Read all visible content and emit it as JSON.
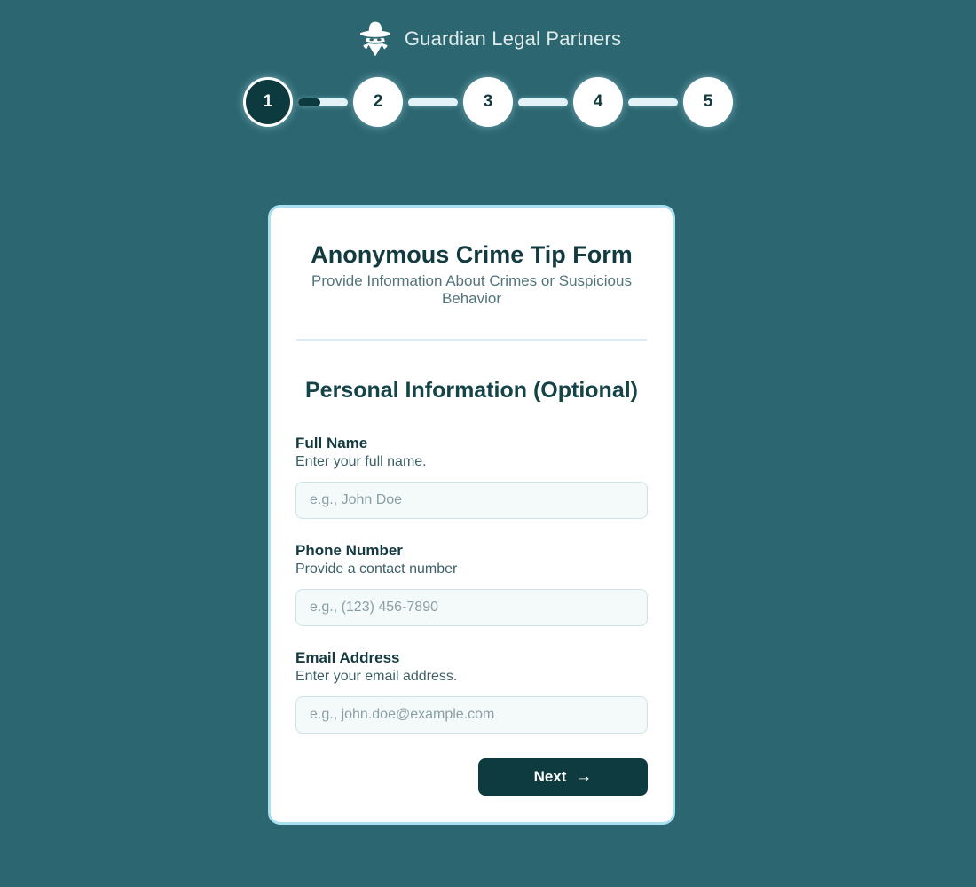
{
  "brand": {
    "name": "Guardian Legal Partners",
    "icon": "detective-icon"
  },
  "stepper": {
    "steps": [
      {
        "label": "1",
        "state": "active"
      },
      {
        "label": "2",
        "state": "upcoming"
      },
      {
        "label": "3",
        "state": "upcoming"
      },
      {
        "label": "4",
        "state": "upcoming"
      },
      {
        "label": "5",
        "state": "upcoming"
      }
    ],
    "connectors": [
      {
        "progress_percent": 45
      },
      {
        "progress_percent": 0
      },
      {
        "progress_percent": 0
      },
      {
        "progress_percent": 0
      }
    ]
  },
  "card": {
    "title": "Anonymous Crime Tip Form",
    "subtitle": "Provide Information About Crimes or Suspicious Behavior",
    "section_title": "Personal Information (Optional)",
    "fields": [
      {
        "label": "Full Name",
        "help": "Enter your full name.",
        "placeholder": "e.g., John Doe",
        "value": ""
      },
      {
        "label": "Phone Number",
        "help": "Provide a contact number",
        "placeholder": "e.g., (123) 456-7890",
        "value": ""
      },
      {
        "label": "Email Address",
        "help": "Enter your email address.",
        "placeholder": "e.g., john.doe@example.com",
        "value": ""
      }
    ],
    "next_label": "Next",
    "next_arrow": "→"
  },
  "colors": {
    "page_background": "#2c6670",
    "card_border": "#a9dff1",
    "accent_dark": "#0e3b3f",
    "title_text": "#123a3f",
    "brand_text": "#dfeaea",
    "input_background": "#f4f9fa",
    "input_border": "#cde3e8",
    "divider": "#dceaf2"
  }
}
